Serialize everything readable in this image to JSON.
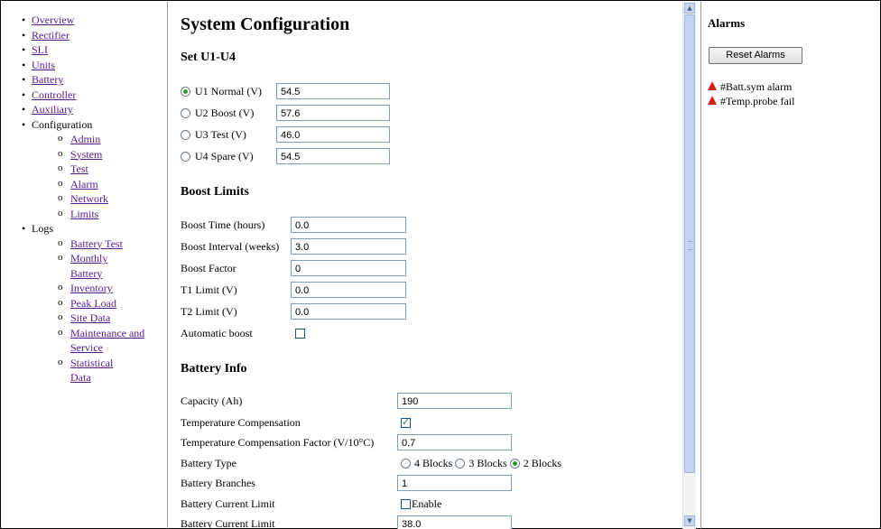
{
  "nav": {
    "items": [
      {
        "label": "Overview"
      },
      {
        "label": "Rectifier"
      },
      {
        "label": "SLI"
      },
      {
        "label": "Units"
      },
      {
        "label": "Battery"
      },
      {
        "label": "Controller"
      },
      {
        "label": "Auxiliary"
      },
      {
        "label": "Configuration",
        "children": [
          {
            "label": "Admin"
          },
          {
            "label": "System"
          },
          {
            "label": "Test"
          },
          {
            "label": "Alarm"
          },
          {
            "label": "Network"
          },
          {
            "label": "Limits"
          }
        ]
      },
      {
        "label": "Logs",
        "children": [
          {
            "label": "Battery Test"
          },
          {
            "label": "Monthly Battery"
          },
          {
            "label": "Inventory"
          },
          {
            "label": "Peak Load"
          },
          {
            "label": "Site Data"
          },
          {
            "label": "Maintenance and Service"
          },
          {
            "label": "Statistical Data"
          }
        ]
      }
    ]
  },
  "main": {
    "title": "System Configuration",
    "set_u": {
      "heading": "Set U1-U4",
      "rows": [
        {
          "label": "U1 Normal (V)",
          "value": "54.5",
          "selected": true
        },
        {
          "label": "U2 Boost (V)",
          "value": "57.6",
          "selected": false
        },
        {
          "label": "U3 Test (V)",
          "value": "46.0",
          "selected": false
        },
        {
          "label": "U4 Spare (V)",
          "value": "54.5",
          "selected": false
        }
      ]
    },
    "boost": {
      "heading": "Boost Limits",
      "rows": [
        {
          "label": "Boost Time (hours)",
          "value": "0.0"
        },
        {
          "label": "Boost Interval (weeks)",
          "value": "3.0"
        },
        {
          "label": "Boost Factor",
          "value": "0"
        },
        {
          "label": "T1 Limit (V)",
          "value": "0.0"
        },
        {
          "label": "T2 Limit (V)",
          "value": "0.0"
        }
      ],
      "auto_label": "Automatic boost",
      "auto_checked": false
    },
    "battery": {
      "heading": "Battery Info",
      "capacity_label": "Capacity (Ah)",
      "capacity_value": "190",
      "tc_label": "Temperature Compensation",
      "tc_checked": true,
      "tcf_label": "Temperature Compensation Factor (V/10°C)",
      "tcf_value": "0.7",
      "type_label": "Battery Type",
      "type_options": [
        "4 Blocks",
        "3 Blocks",
        "2 Blocks"
      ],
      "type_selected": "2 Blocks",
      "branches_label": "Battery Branches",
      "branches_value": "1",
      "current_limit_label": "Battery Current Limit",
      "enable_label": "Enable",
      "enable_checked": false,
      "current_limit_label2": "Battery Current Limit",
      "current_limit_value": "38.0"
    }
  },
  "alarms": {
    "heading": "Alarms",
    "reset_label": "Reset Alarms",
    "items": [
      "#Batt.sym alarm",
      "#Temp.probe fail"
    ],
    "icon": "warning-triangle-icon",
    "icon_color": "#d41f1f"
  },
  "colors": {
    "link": "#551a8b",
    "radio_selected": "#2e9d2e",
    "checkbox_check": "#21a121"
  }
}
